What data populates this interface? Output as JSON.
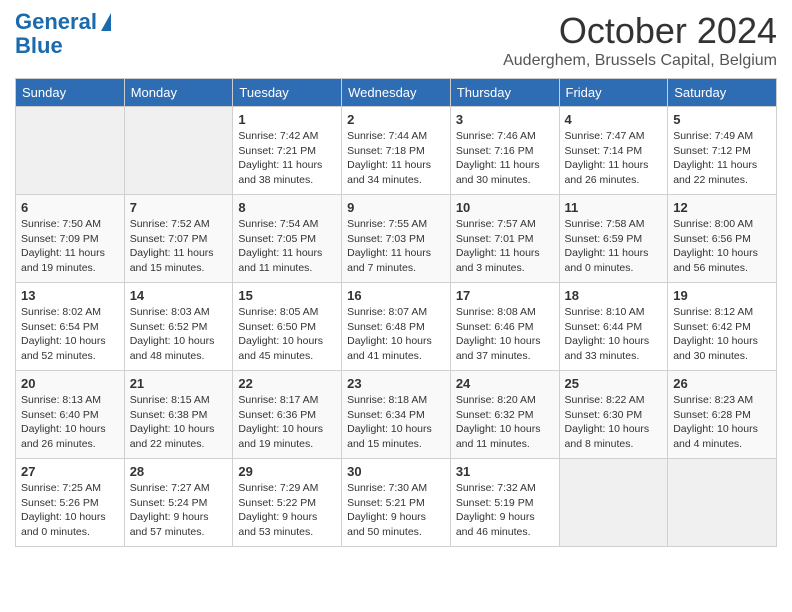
{
  "header": {
    "logo_line1": "General",
    "logo_line2": "Blue",
    "month": "October 2024",
    "location": "Auderghem, Brussels Capital, Belgium"
  },
  "days_of_week": [
    "Sunday",
    "Monday",
    "Tuesday",
    "Wednesday",
    "Thursday",
    "Friday",
    "Saturday"
  ],
  "weeks": [
    [
      {
        "day": "",
        "empty": true
      },
      {
        "day": "",
        "empty": true
      },
      {
        "day": "1",
        "sunrise": "Sunrise: 7:42 AM",
        "sunset": "Sunset: 7:21 PM",
        "daylight": "Daylight: 11 hours and 38 minutes."
      },
      {
        "day": "2",
        "sunrise": "Sunrise: 7:44 AM",
        "sunset": "Sunset: 7:18 PM",
        "daylight": "Daylight: 11 hours and 34 minutes."
      },
      {
        "day": "3",
        "sunrise": "Sunrise: 7:46 AM",
        "sunset": "Sunset: 7:16 PM",
        "daylight": "Daylight: 11 hours and 30 minutes."
      },
      {
        "day": "4",
        "sunrise": "Sunrise: 7:47 AM",
        "sunset": "Sunset: 7:14 PM",
        "daylight": "Daylight: 11 hours and 26 minutes."
      },
      {
        "day": "5",
        "sunrise": "Sunrise: 7:49 AM",
        "sunset": "Sunset: 7:12 PM",
        "daylight": "Daylight: 11 hours and 22 minutes."
      }
    ],
    [
      {
        "day": "6",
        "sunrise": "Sunrise: 7:50 AM",
        "sunset": "Sunset: 7:09 PM",
        "daylight": "Daylight: 11 hours and 19 minutes."
      },
      {
        "day": "7",
        "sunrise": "Sunrise: 7:52 AM",
        "sunset": "Sunset: 7:07 PM",
        "daylight": "Daylight: 11 hours and 15 minutes."
      },
      {
        "day": "8",
        "sunrise": "Sunrise: 7:54 AM",
        "sunset": "Sunset: 7:05 PM",
        "daylight": "Daylight: 11 hours and 11 minutes."
      },
      {
        "day": "9",
        "sunrise": "Sunrise: 7:55 AM",
        "sunset": "Sunset: 7:03 PM",
        "daylight": "Daylight: 11 hours and 7 minutes."
      },
      {
        "day": "10",
        "sunrise": "Sunrise: 7:57 AM",
        "sunset": "Sunset: 7:01 PM",
        "daylight": "Daylight: 11 hours and 3 minutes."
      },
      {
        "day": "11",
        "sunrise": "Sunrise: 7:58 AM",
        "sunset": "Sunset: 6:59 PM",
        "daylight": "Daylight: 11 hours and 0 minutes."
      },
      {
        "day": "12",
        "sunrise": "Sunrise: 8:00 AM",
        "sunset": "Sunset: 6:56 PM",
        "daylight": "Daylight: 10 hours and 56 minutes."
      }
    ],
    [
      {
        "day": "13",
        "sunrise": "Sunrise: 8:02 AM",
        "sunset": "Sunset: 6:54 PM",
        "daylight": "Daylight: 10 hours and 52 minutes."
      },
      {
        "day": "14",
        "sunrise": "Sunrise: 8:03 AM",
        "sunset": "Sunset: 6:52 PM",
        "daylight": "Daylight: 10 hours and 48 minutes."
      },
      {
        "day": "15",
        "sunrise": "Sunrise: 8:05 AM",
        "sunset": "Sunset: 6:50 PM",
        "daylight": "Daylight: 10 hours and 45 minutes."
      },
      {
        "day": "16",
        "sunrise": "Sunrise: 8:07 AM",
        "sunset": "Sunset: 6:48 PM",
        "daylight": "Daylight: 10 hours and 41 minutes."
      },
      {
        "day": "17",
        "sunrise": "Sunrise: 8:08 AM",
        "sunset": "Sunset: 6:46 PM",
        "daylight": "Daylight: 10 hours and 37 minutes."
      },
      {
        "day": "18",
        "sunrise": "Sunrise: 8:10 AM",
        "sunset": "Sunset: 6:44 PM",
        "daylight": "Daylight: 10 hours and 33 minutes."
      },
      {
        "day": "19",
        "sunrise": "Sunrise: 8:12 AM",
        "sunset": "Sunset: 6:42 PM",
        "daylight": "Daylight: 10 hours and 30 minutes."
      }
    ],
    [
      {
        "day": "20",
        "sunrise": "Sunrise: 8:13 AM",
        "sunset": "Sunset: 6:40 PM",
        "daylight": "Daylight: 10 hours and 26 minutes."
      },
      {
        "day": "21",
        "sunrise": "Sunrise: 8:15 AM",
        "sunset": "Sunset: 6:38 PM",
        "daylight": "Daylight: 10 hours and 22 minutes."
      },
      {
        "day": "22",
        "sunrise": "Sunrise: 8:17 AM",
        "sunset": "Sunset: 6:36 PM",
        "daylight": "Daylight: 10 hours and 19 minutes."
      },
      {
        "day": "23",
        "sunrise": "Sunrise: 8:18 AM",
        "sunset": "Sunset: 6:34 PM",
        "daylight": "Daylight: 10 hours and 15 minutes."
      },
      {
        "day": "24",
        "sunrise": "Sunrise: 8:20 AM",
        "sunset": "Sunset: 6:32 PM",
        "daylight": "Daylight: 10 hours and 11 minutes."
      },
      {
        "day": "25",
        "sunrise": "Sunrise: 8:22 AM",
        "sunset": "Sunset: 6:30 PM",
        "daylight": "Daylight: 10 hours and 8 minutes."
      },
      {
        "day": "26",
        "sunrise": "Sunrise: 8:23 AM",
        "sunset": "Sunset: 6:28 PM",
        "daylight": "Daylight: 10 hours and 4 minutes."
      }
    ],
    [
      {
        "day": "27",
        "sunrise": "Sunrise: 7:25 AM",
        "sunset": "Sunset: 5:26 PM",
        "daylight": "Daylight: 10 hours and 0 minutes."
      },
      {
        "day": "28",
        "sunrise": "Sunrise: 7:27 AM",
        "sunset": "Sunset: 5:24 PM",
        "daylight": "Daylight: 9 hours and 57 minutes."
      },
      {
        "day": "29",
        "sunrise": "Sunrise: 7:29 AM",
        "sunset": "Sunset: 5:22 PM",
        "daylight": "Daylight: 9 hours and 53 minutes."
      },
      {
        "day": "30",
        "sunrise": "Sunrise: 7:30 AM",
        "sunset": "Sunset: 5:21 PM",
        "daylight": "Daylight: 9 hours and 50 minutes."
      },
      {
        "day": "31",
        "sunrise": "Sunrise: 7:32 AM",
        "sunset": "Sunset: 5:19 PM",
        "daylight": "Daylight: 9 hours and 46 minutes."
      },
      {
        "day": "",
        "empty": true
      },
      {
        "day": "",
        "empty": true
      }
    ]
  ]
}
